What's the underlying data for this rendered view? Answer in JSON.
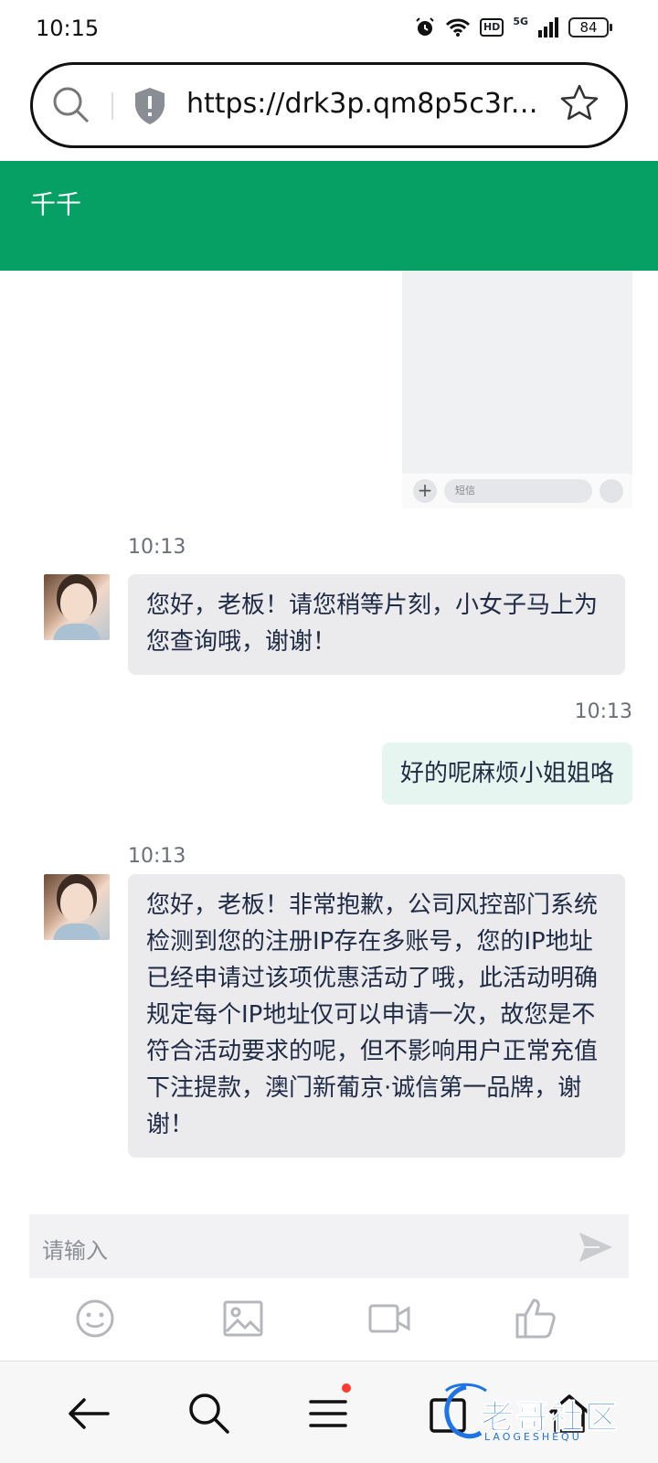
{
  "status_bar": {
    "time": "10:15",
    "network_label": "5G",
    "hd_label": "HD",
    "battery": "84"
  },
  "browser": {
    "url": "https://drk3p.qm8p5c3r.x..."
  },
  "header": {
    "title": "千千",
    "color": "#06a064"
  },
  "shared_screenshot": {
    "input_placeholder": "短信"
  },
  "messages": [
    {
      "side": "left",
      "time": "10:13",
      "text": "您好，老板！请您稍等片刻，小女子马上为您查询哦，谢谢！"
    },
    {
      "side": "right",
      "time": "10:13",
      "text": "好的呢麻烦小姐姐咯"
    },
    {
      "side": "left",
      "time": "10:13",
      "text": "您好，老板！非常抱歉，公司风控部门系统检测到您的注册IP存在多账号，您的IP地址已经申请过该项优惠活动了哦，此活动明确规定每个IP地址仅可以申请一次，故您是不符合活动要求的呢，但不影响用户正常充值下注提款，澳门新葡京·诚信第一品牌，谢谢！"
    }
  ],
  "composer": {
    "placeholder": "请输入"
  },
  "toolbar_icons": [
    "emoji-icon",
    "image-icon",
    "video-icon",
    "thumbs-up-icon"
  ],
  "nav_icons": [
    "back-arrow-icon",
    "search-icon",
    "menu-icon",
    "tabs-icon",
    "home-icon"
  ],
  "watermark": {
    "text": "老哥社区",
    "sub": "LAOGESHEQU"
  }
}
